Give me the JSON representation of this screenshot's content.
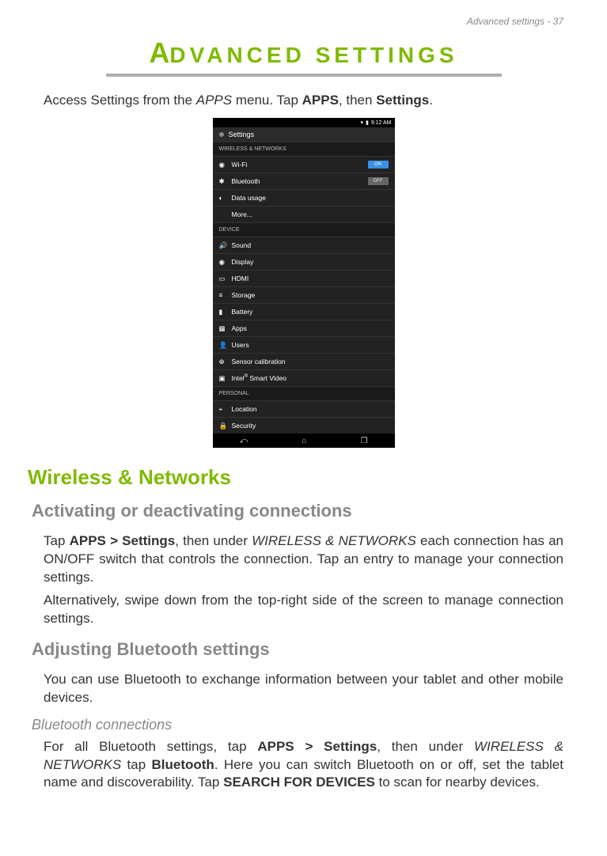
{
  "header": "Advanced settings - 37",
  "title_first": "A",
  "title_rest": "DVANCED SETTINGS",
  "intro": {
    "pre": "Access Settings from the ",
    "apps_ital": "APPS",
    "mid": " menu. Tap ",
    "apps_bold": "APPS",
    "then": ", then ",
    "settings_bold": "Settings",
    "end": "."
  },
  "shot": {
    "time": "9:12 AM",
    "app_title": "Settings",
    "sections": {
      "wireless": "WIRELESS & NETWORKS",
      "device": "DEVICE",
      "personal": "PERSONAL"
    },
    "rows": {
      "wifi": "Wi-Fi",
      "wifi_toggle": "ON",
      "bt": "Bluetooth",
      "bt_toggle": "OFF",
      "data": "Data usage",
      "more": "More...",
      "sound": "Sound",
      "display": "Display",
      "hdmi": "HDMI",
      "storage": "Storage",
      "battery": "Battery",
      "apps": "Apps",
      "users": "Users",
      "sensor": "Sensor calibration",
      "intel_pre": "Intel",
      "intel_sup": "®",
      "intel_post": " Smart Video",
      "location": "Location",
      "security": "Security"
    }
  },
  "h1_wireless": "Wireless & Networks",
  "h2_activating": "Activating or deactivating connections",
  "p_activating_1": {
    "t1": "Tap ",
    "b1": "APPS > Settings",
    "t2": ", then under ",
    "i1": "WIRELESS & NETWORKS",
    "t3": " each connection has an ON/OFF switch that controls the connection. Tap an entry to manage your connection settings."
  },
  "p_activating_2": "Alternatively, swipe down from the top-right side of the screen to manage connection settings.",
  "h2_bt": "Adjusting Bluetooth settings",
  "p_bt_1": "You can use Bluetooth to exchange information between your tablet and other mobile devices.",
  "h3_btconn": "Bluetooth connections",
  "p_btconn": {
    "t1": "For all Bluetooth settings, tap ",
    "b1": "APPS > Settings",
    "t2": ", then under ",
    "i1": "WIRELESS & NETWORKS",
    "t3": " tap ",
    "b2": "Bluetooth",
    "t4": ". Here you can switch Bluetooth on or off, set the tablet name and discoverability. Tap ",
    "b3": "SEARCH FOR DEVICES",
    "t5": " to scan for nearby devices."
  }
}
